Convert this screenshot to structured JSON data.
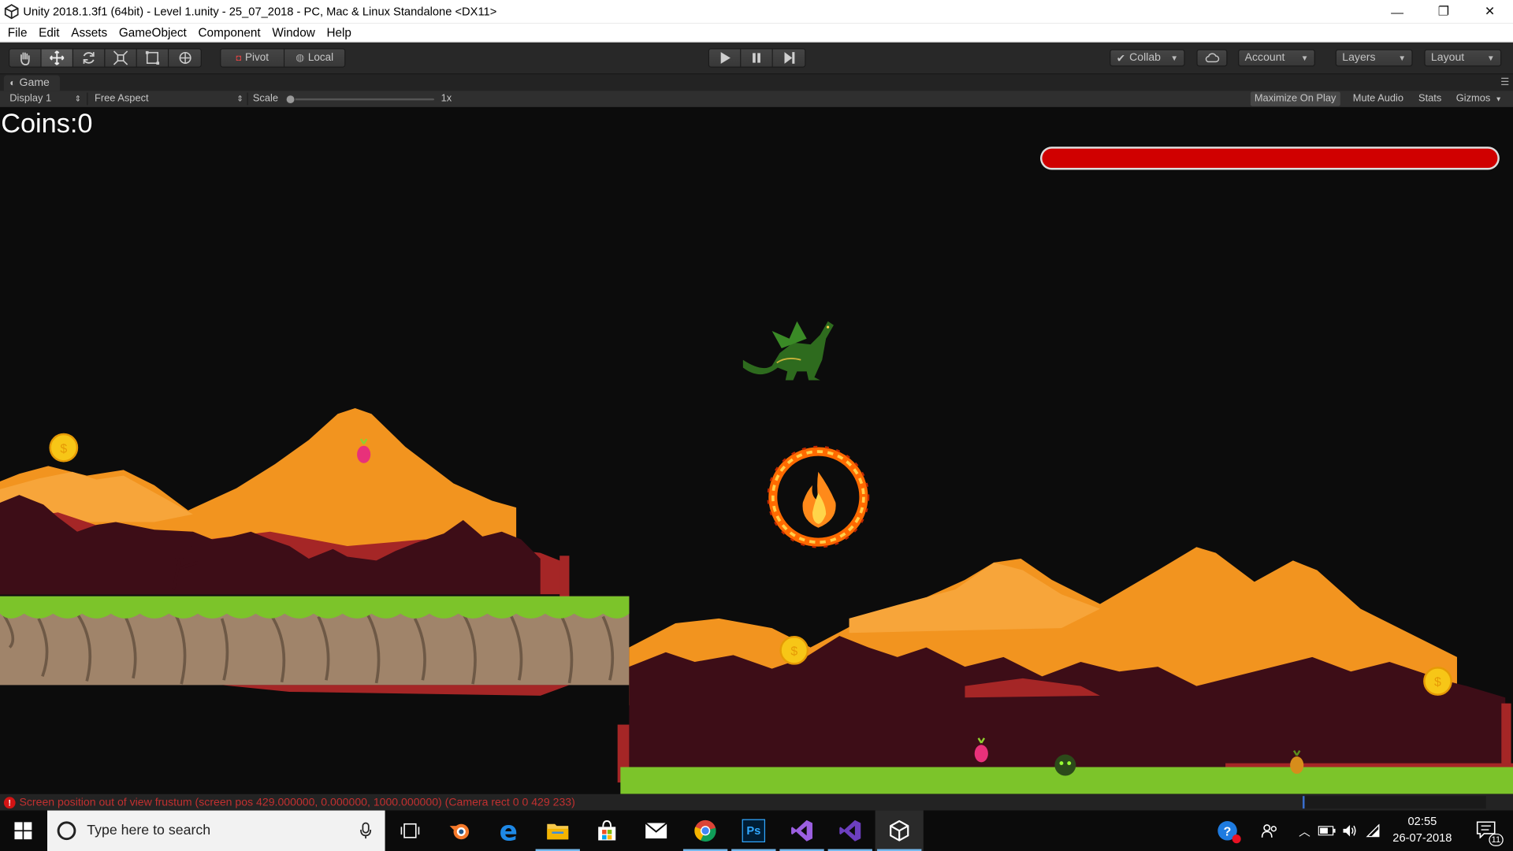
{
  "window": {
    "title": "Unity 2018.1.3f1 (64bit) - Level 1.unity - 25_07_2018 - PC, Mac & Linux Standalone <DX11>",
    "minimize": "—",
    "restore": "❐",
    "close": "✕"
  },
  "menu": [
    "File",
    "Edit",
    "Assets",
    "GameObject",
    "Component",
    "Window",
    "Help"
  ],
  "toolbar": {
    "pivot": "Pivot",
    "local": "Local",
    "collab": "Collab",
    "account": "Account",
    "layers": "Layers",
    "layout": "Layout"
  },
  "game_tab": {
    "title": "Game",
    "display": "Display 1",
    "aspect": "Free Aspect",
    "scale_label": "Scale",
    "scale_value": "1x",
    "maximize_on_play": "Maximize On Play",
    "mute_audio": "Mute Audio",
    "stats": "Stats",
    "gizmos": "Gizmos"
  },
  "game": {
    "coins_text": "Coins:0",
    "health_fraction": 1.0
  },
  "status": {
    "error_text": "Screen position out of view frustum (screen pos 429.000000, 0.000000, 1000.000000) (Camera rect 0 0 429 233)"
  },
  "taskbar": {
    "search_placeholder": "Type here to search",
    "time": "02:55",
    "date": "26-07-2018",
    "notification_count": "11",
    "apps": [
      "blender-icon",
      "edge-icon",
      "file-explorer-icon",
      "store-icon",
      "mail-icon",
      "chrome-icon",
      "photoshop-icon",
      "visual-studio-icon",
      "visual-studio-preview-icon",
      "unity-icon"
    ]
  },
  "colors": {
    "accent_red": "#d00000",
    "mountain_light": "#f2941f",
    "mountain_dark": "#4a0e1a",
    "grass": "#7cc42a",
    "error_red": "#c23030"
  }
}
